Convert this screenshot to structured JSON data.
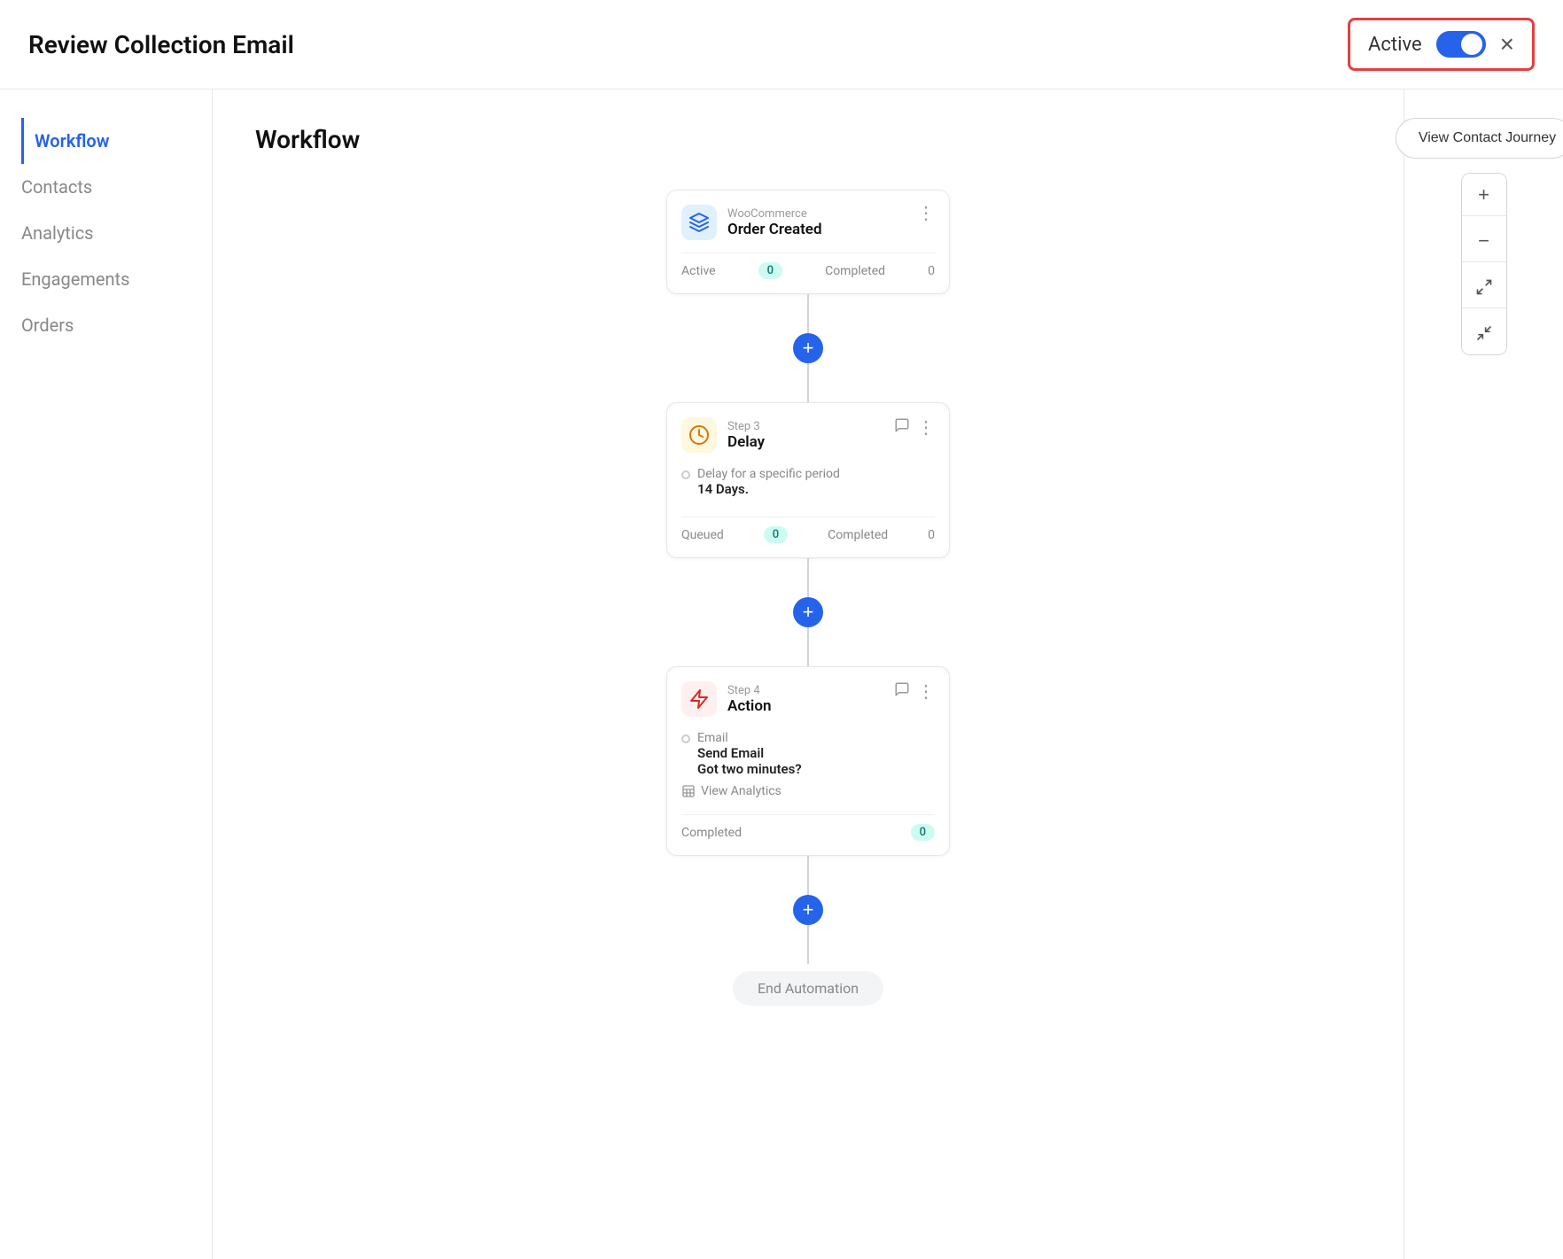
{
  "header": {
    "title": "Review Collection Email",
    "active_label": "Active",
    "close_icon": "×"
  },
  "sidebar": {
    "items": [
      {
        "id": "workflow",
        "label": "Workflow",
        "active": true
      },
      {
        "id": "contacts",
        "label": "Contacts",
        "active": false
      },
      {
        "id": "analytics",
        "label": "Analytics",
        "active": false
      },
      {
        "id": "engagements",
        "label": "Engagements",
        "active": false
      },
      {
        "id": "orders",
        "label": "Orders",
        "active": false
      }
    ]
  },
  "content": {
    "title": "Workflow",
    "nodes": [
      {
        "id": "trigger",
        "type": "trigger",
        "provider": "WooCommerce",
        "title": "Order Created",
        "stats": {
          "active_label": "Active",
          "active_count": "0",
          "completed_label": "Completed",
          "completed_count": "0"
        }
      },
      {
        "id": "delay",
        "type": "delay",
        "step": "Step 3",
        "title": "Delay",
        "detail_label": "Delay for a specific period",
        "detail_value": "14 Days.",
        "stats": {
          "queued_label": "Queued",
          "queued_count": "0",
          "completed_label": "Completed",
          "completed_count": "0"
        }
      },
      {
        "id": "action",
        "type": "action",
        "step": "Step 4",
        "title": "Action",
        "email_label": "Email",
        "email_action": "Send Email",
        "email_subject": "Got two minutes?",
        "view_analytics_label": "View Analytics",
        "stats": {
          "completed_label": "Completed",
          "completed_count": "0"
        }
      }
    ],
    "end_label": "End Automation"
  },
  "right_panel": {
    "view_journey_label": "View Contact Journey",
    "zoom_in": "+",
    "zoom_out": "−"
  }
}
